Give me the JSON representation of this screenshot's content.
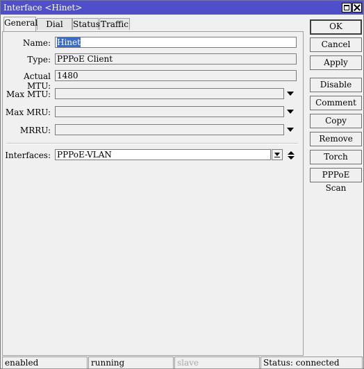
{
  "window": {
    "title": "Interface <Hinet>"
  },
  "tabs": [
    "General",
    "Dial Out",
    "Status",
    "Traffic"
  ],
  "form": {
    "name": {
      "label": "Name:",
      "value": "Hinet"
    },
    "type": {
      "label": "Type:",
      "value": "PPPoE Client"
    },
    "actual_mtu": {
      "label": "Actual MTU:",
      "value": "1480"
    },
    "max_mtu": {
      "label": "Max MTU:",
      "value": ""
    },
    "max_mru": {
      "label": "Max MRU:",
      "value": ""
    },
    "mrru": {
      "label": "MRRU:",
      "value": ""
    },
    "interfaces": {
      "label": "Interfaces:",
      "value": "PPPoE-VLAN"
    }
  },
  "buttons": [
    "OK",
    "Cancel",
    "Apply",
    "Disable",
    "Comment",
    "Copy",
    "Remove",
    "Torch",
    "PPPoE Scan"
  ],
  "statusbar": [
    "enabled",
    "running",
    "slave",
    "Status: connected"
  ],
  "colors": {
    "titlebar": "#4f4fc9",
    "selection": "#3a6cc8"
  }
}
